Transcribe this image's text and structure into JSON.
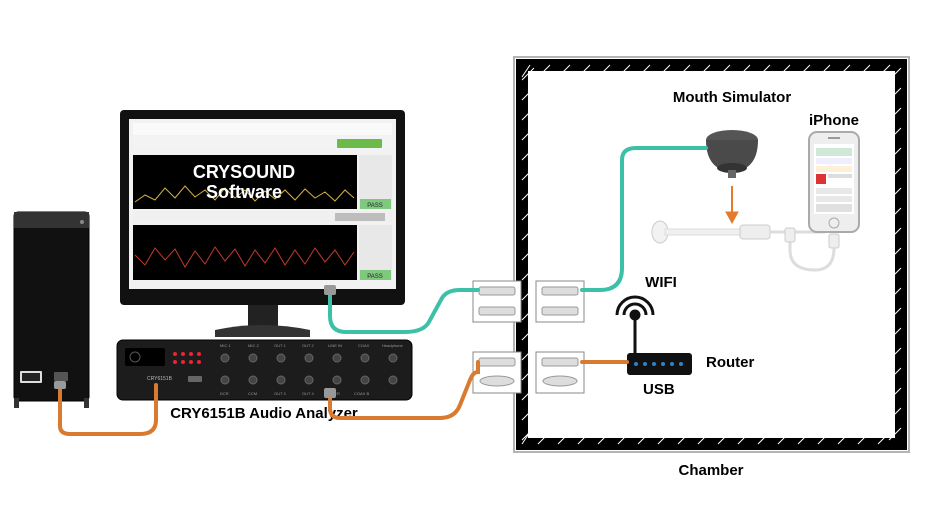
{
  "labels": {
    "software_line1": "CRYSOUND",
    "software_line2": "Software",
    "analyzer": "CRY6151B Audio Analyzer",
    "analyzer_model": "CRY6151B",
    "mouth_simulator": "Mouth Simulator",
    "iphone": "iPhone",
    "wifi": "WIFI",
    "router": "Router",
    "usb": "USB",
    "chamber": "Chamber"
  },
  "colors": {
    "cable_teal": "#3cc0a8",
    "cable_orange": "#d97a2e",
    "pass": "#7fc97f",
    "run": "#6cba4a",
    "router_dark": "#222"
  }
}
